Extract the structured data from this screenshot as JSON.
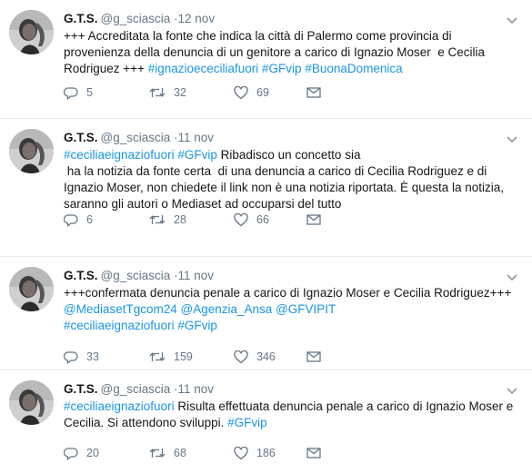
{
  "tweets": [
    {
      "name": "G.T.S.",
      "handle": "@g_sciascia",
      "date": "12 nov",
      "parts": [
        {
          "t": "+++ Accreditata la fonte che indica la città di Palermo come provincia di provenienza della denuncia di un genitore a carico di Ignazio Moser  e Cecilia Rodriguez +++ "
        },
        {
          "t": "#ignazioececiliafuori",
          "link": true
        },
        {
          "t": " "
        },
        {
          "t": "#GFvip",
          "link": true
        },
        {
          "t": " "
        },
        {
          "t": "#BuonaDomenica",
          "link": true
        }
      ],
      "replies": "5",
      "retweets": "32",
      "likes": "69"
    },
    {
      "name": "G.T.S.",
      "handle": "@g_sciascia",
      "date": "11 nov",
      "parts": [
        {
          "t": "#ceciliaeignaziofuori",
          "link": true
        },
        {
          "t": " "
        },
        {
          "t": "#GFvip",
          "link": true
        },
        {
          "t": " Ribadisco un concetto sia\n ha la notizia da fonte certa  di una denuncia a carico di Cecilia Rodriguez e di Ignazio Moser, non chiedete il link non è una notizia riportata. È questa la notizia, saranno gli autori o Mediaset ad occuparsi del tutto"
        }
      ],
      "replies": "6",
      "retweets": "28",
      "likes": "66"
    },
    {
      "name": "G.T.S.",
      "handle": "@g_sciascia",
      "date": "11 nov",
      "parts": [
        {
          "t": "+++confermata denuncia penale a carico di Ignazio Moser e Cecilia Rodriguez+++ "
        },
        {
          "t": "@MediasetTgcom24",
          "link": true
        },
        {
          "t": " "
        },
        {
          "t": "@Agenzia_Ansa",
          "link": true
        },
        {
          "t": " "
        },
        {
          "t": "@GFVIPIT",
          "link": true
        },
        {
          "t": "\n"
        },
        {
          "t": "#ceciliaeignaziofuori",
          "link": true
        },
        {
          "t": " "
        },
        {
          "t": "#GFvip",
          "link": true
        }
      ],
      "replies": "33",
      "retweets": "159",
      "likes": "346"
    },
    {
      "name": "G.T.S.",
      "handle": "@g_sciascia",
      "date": "11 nov",
      "parts": [
        {
          "t": "#ceciliaeignaziofuori",
          "link": true
        },
        {
          "t": " Risulta effettuata denuncia penale a carico di Ignazio Moser e Cecilia. Si attendono sviluppi. "
        },
        {
          "t": "#GFvip",
          "link": true
        }
      ],
      "replies": "20",
      "retweets": "68",
      "likes": "186"
    }
  ],
  "icons": {
    "avatar": "profile-photo",
    "caret": "chevron-down-icon",
    "reply": "reply-icon",
    "retweet": "retweet-icon",
    "like": "heart-icon",
    "dm": "envelope-icon"
  },
  "colors": {
    "link": "#1b95e0",
    "muted": "#657786",
    "text": "#14171a",
    "divider": "#e6ecf0"
  }
}
